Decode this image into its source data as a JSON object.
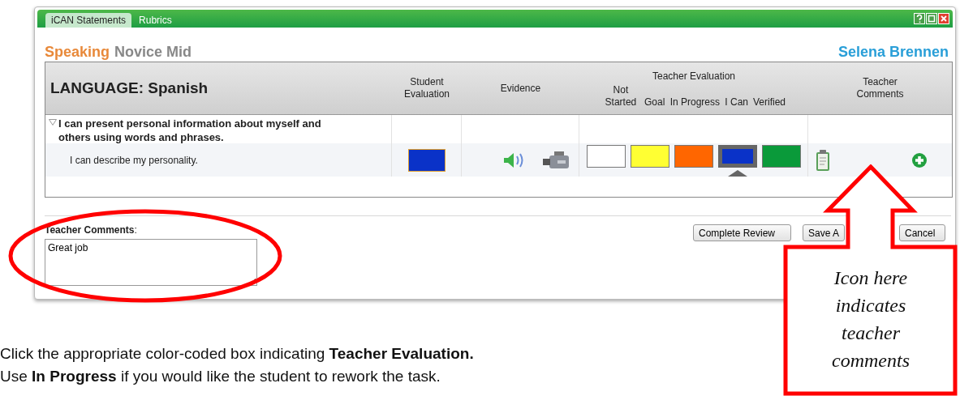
{
  "window": {
    "tabs": [
      {
        "label": "iCAN Statements",
        "selected": true
      },
      {
        "label": "Rubrics",
        "selected": false
      }
    ]
  },
  "heading": {
    "skill": "Speaking",
    "level": "Novice Mid",
    "student": "Selena Brennen"
  },
  "table": {
    "title": "LANGUAGE: Spanish",
    "student_evaluation": "Student Evaluation",
    "evidence": "Evidence",
    "teacher_evaluation": "Teacher Evaluation",
    "levels": [
      "Not Started",
      "Goal",
      "In Progress",
      "I Can",
      "Verified"
    ],
    "teacher_comments": "Teacher Comments",
    "statements": [
      {
        "text": "I can present personal information about myself and others using words and phrases.",
        "expanded": true,
        "children": [
          {
            "text": "I can describe my personality.",
            "student_evaluation": {
              "color": "#0a32c8"
            },
            "has_audio": true,
            "has_video": true,
            "has_comments": true,
            "levels": [
              {
                "color": "#ffffff",
                "selected": false
              },
              {
                "color": "#ffff33",
                "selected": false
              },
              {
                "color": "#ff6600",
                "selected": false
              },
              {
                "color": "#0a32c8",
                "selected": true
              },
              {
                "color": "#0a9a3a",
                "selected": false
              }
            ]
          }
        ]
      }
    ]
  },
  "comments": {
    "label": "**Teacher Comments**:",
    "value": "Great job"
  },
  "buttons": [
    "Complete Review",
    "Save A",
    "Cancel"
  ],
  "callout": "Icon here indicates teacher comments",
  "caption": [
    "Click the appropriate color-coded box indicating **Teacher Evaluation.**",
    "Use **In Progress** if you would like the student to rework the task."
  ]
}
